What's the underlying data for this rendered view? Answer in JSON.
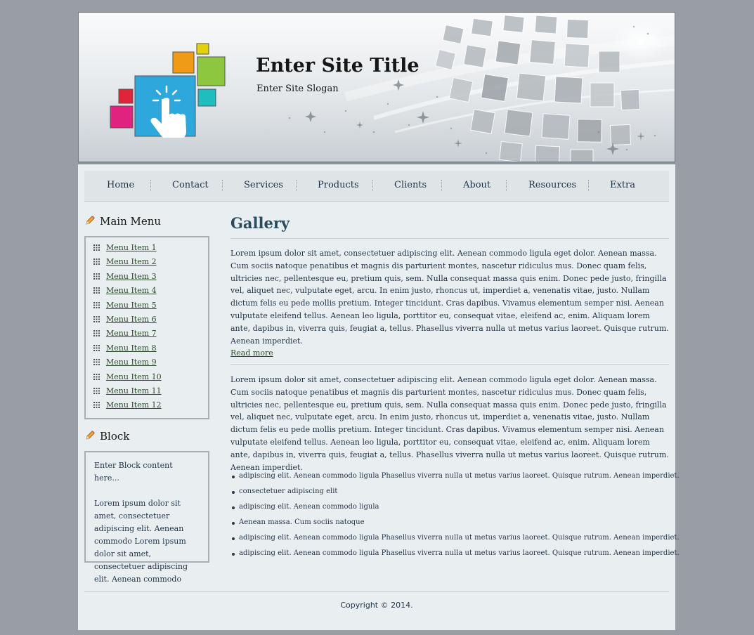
{
  "header": {
    "site_title": "Enter Site Title",
    "site_slogan": "Enter Site Slogan"
  },
  "nav": {
    "items": [
      {
        "label": "Home"
      },
      {
        "label": "Contact"
      },
      {
        "label": "Services"
      },
      {
        "label": "Products"
      },
      {
        "label": "Clients"
      },
      {
        "label": "About"
      },
      {
        "label": "Resources"
      },
      {
        "label": "Extra"
      }
    ]
  },
  "sidebar": {
    "main_menu_title": "Main Menu",
    "menu_items": [
      {
        "label": "Menu Item 1"
      },
      {
        "label": "Menu Item 2"
      },
      {
        "label": "Menu Item 3"
      },
      {
        "label": "Menu Item 4"
      },
      {
        "label": "Menu Item 5"
      },
      {
        "label": "Menu Item 6"
      },
      {
        "label": "Menu Item 7"
      },
      {
        "label": "Menu Item 8"
      },
      {
        "label": "Menu Item 9"
      },
      {
        "label": "Menu Item 10"
      },
      {
        "label": "Menu Item 11"
      },
      {
        "label": "Menu Item 12"
      }
    ],
    "block_title": "Block",
    "block_intro": "Enter Block content here...",
    "block_text": "Lorem ipsum dolor sit amet, consectetuer adipiscing elit. Aenean commodo Lorem ipsum dolor sit amet, consectetuer adipiscing elit. Aenean commodo"
  },
  "main": {
    "title": "Gallery",
    "paragraph_1": "Lorem ipsum dolor sit amet, consectetuer adipiscing elit. Aenean commodo ligula eget dolor. Aenean massa. Cum sociis natoque penatibus et magnis dis parturient montes, nascetur ridiculus mus. Donec quam felis, ultricies nec, pellentesque eu, pretium quis, sem. Nulla consequat massa quis enim. Donec pede justo, fringilla vel, aliquet nec, vulputate eget, arcu. In enim justo, rhoncus ut, imperdiet a, venenatis vitae, justo. Nullam dictum felis eu pede mollis pretium. Integer tincidunt. Cras dapibus. Vivamus elementum semper nisi. Aenean vulputate eleifend tellus. Aenean leo ligula, porttitor eu, consequat vitae, eleifend ac, enim. Aliquam lorem ante, dapibus in, viverra quis, feugiat a, tellus. Phasellus viverra nulla ut metus varius laoreet. Quisque rutrum. Aenean imperdiet.",
    "read_more": "Read more",
    "paragraph_2": "Lorem ipsum dolor sit amet, consectetuer adipiscing elit. Aenean commodo ligula eget dolor. Aenean massa. Cum sociis natoque penatibus et magnis dis parturient montes, nascetur ridiculus mus. Donec quam felis, ultricies nec, pellentesque eu, pretium quis, sem. Nulla consequat massa quis enim. Donec pede justo, fringilla vel, aliquet nec, vulputate eget, arcu. In enim justo, rhoncus ut, imperdiet a, venenatis vitae, justo. Nullam dictum felis eu pede mollis pretium. Integer tincidunt. Cras dapibus. Vivamus elementum semper nisi. Aenean vulputate eleifend tellus. Aenean leo ligula, porttitor eu, consequat vitae, eleifend ac, enim. Aliquam lorem ante, dapibus in, viverra quis, feugiat a, tellus. Phasellus viverra nulla ut metus varius laoreet. Quisque rutrum. Aenean imperdiet.",
    "bullets": [
      "adipiscing elit. Aenean commodo ligula Phasellus viverra nulla ut metus varius laoreet. Quisque rutrum. Aenean imperdiet.",
      "consectetuer adipiscing elit",
      "adipiscing elit. Aenean commodo ligula",
      "Aenean massa. Cum sociis natoque",
      "adipiscing elit. Aenean commodo ligula Phasellus viverra nulla ut metus varius laoreet. Quisque rutrum. Aenean imperdiet.",
      "adipiscing elit. Aenean commodo ligula Phasellus viverra nulla ut metus varius laoreet. Quisque rutrum. Aenean imperdiet."
    ]
  },
  "footer": {
    "copyright": "Copyright © 2014."
  },
  "icons": {
    "logo": "touch-hand-logo-icon",
    "heading": "pencil-icon",
    "menu_bullet": "grid-icon",
    "list_bullet": "bullet-dot-icon"
  },
  "colors": {
    "page_background": "#989ea3",
    "content_background": "#e9eef0",
    "nav_background": "#dfe4e7",
    "text": "#1f3346",
    "link": "#2c4a2c",
    "logo_blue": "#2ea8dc",
    "logo_orange": "#f19a15",
    "logo_green": "#8dc63f",
    "logo_yellow": "#e3d10b",
    "logo_teal": "#1fbcc0",
    "logo_red": "#e0243a",
    "logo_magenta": "#e0237f"
  }
}
